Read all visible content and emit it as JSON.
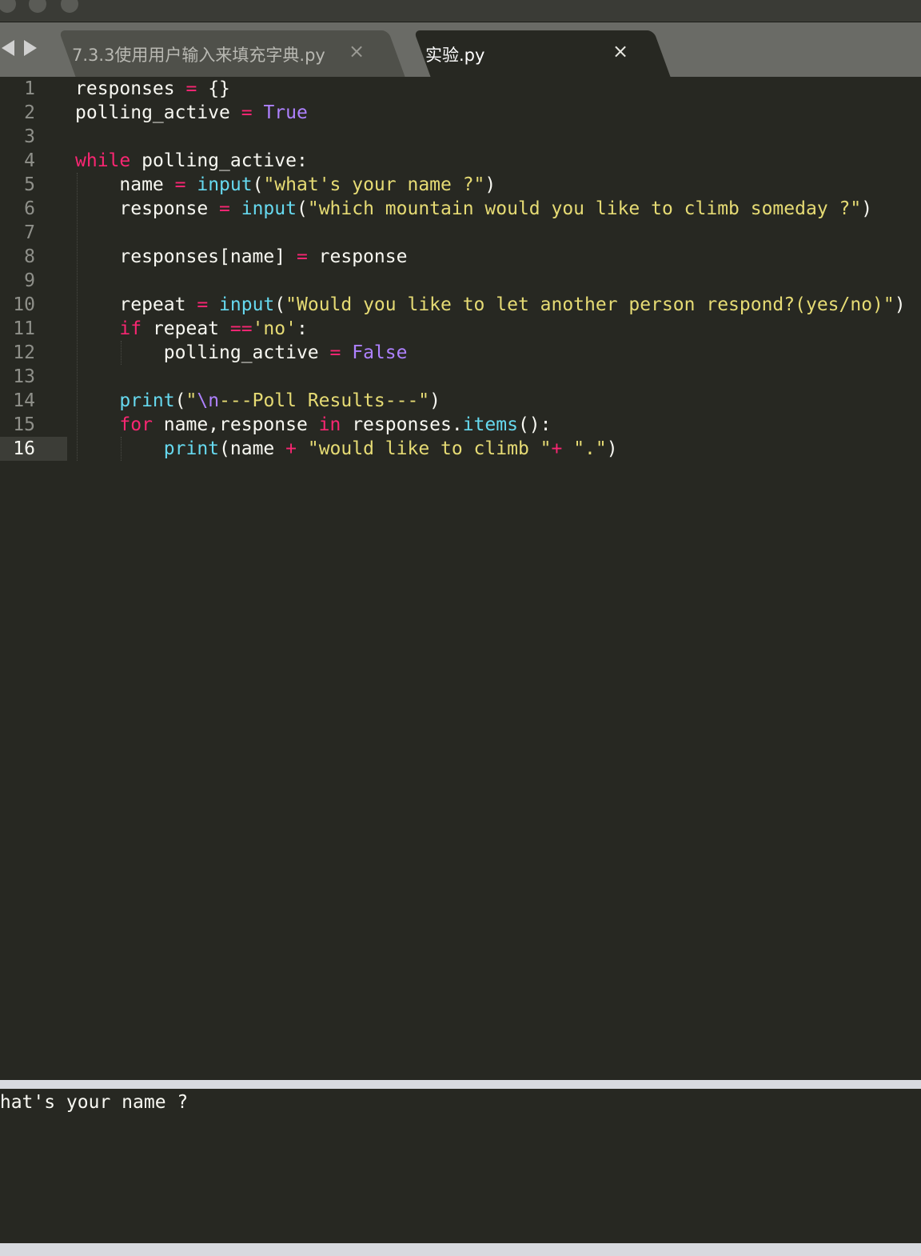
{
  "tabs": [
    {
      "label": "7.3.3使用用户输入来填充字典.py",
      "active": false
    },
    {
      "label": "实验.py",
      "active": true
    }
  ],
  "icons": {
    "back": "triangle-left-icon",
    "forward": "triangle-right-icon",
    "close": "×"
  },
  "editor": {
    "current_line": 16,
    "lines": [
      [
        [
          "responses ",
          "v"
        ],
        [
          "=",
          "k"
        ],
        [
          " {}",
          "v"
        ]
      ],
      [
        [
          "polling_active ",
          "v"
        ],
        [
          "=",
          "k"
        ],
        [
          " ",
          "v"
        ],
        [
          "True",
          "c"
        ]
      ],
      [],
      [
        [
          "while",
          "k"
        ],
        [
          " polling_active:",
          "v"
        ]
      ],
      [
        [
          "    name ",
          "v"
        ],
        [
          "=",
          "k"
        ],
        [
          " ",
          "v"
        ],
        [
          "input",
          "f"
        ],
        [
          "(",
          "v"
        ],
        [
          "\"what's your name ?\"",
          "s"
        ],
        [
          ")",
          "v"
        ]
      ],
      [
        [
          "    response ",
          "v"
        ],
        [
          "=",
          "k"
        ],
        [
          " ",
          "v"
        ],
        [
          "input",
          "f"
        ],
        [
          "(",
          "v"
        ],
        [
          "\"which mountain would you like to climb someday ?\"",
          "s"
        ],
        [
          ")",
          "v"
        ]
      ],
      [],
      [
        [
          "    responses[name] ",
          "v"
        ],
        [
          "=",
          "k"
        ],
        [
          " response",
          "v"
        ]
      ],
      [],
      [
        [
          "    repeat ",
          "v"
        ],
        [
          "=",
          "k"
        ],
        [
          " ",
          "v"
        ],
        [
          "input",
          "f"
        ],
        [
          "(",
          "v"
        ],
        [
          "\"Would you like to let another person respond?(yes/no)\"",
          "s"
        ],
        [
          ")",
          "v"
        ]
      ],
      [
        [
          "    ",
          "v"
        ],
        [
          "if",
          "k"
        ],
        [
          " repeat ",
          "v"
        ],
        [
          "==",
          "k"
        ],
        [
          "'no'",
          "s"
        ],
        [
          ":",
          "v"
        ]
      ],
      [
        [
          "        polling_active ",
          "v"
        ],
        [
          "=",
          "k"
        ],
        [
          " ",
          "v"
        ],
        [
          "False",
          "c"
        ]
      ],
      [],
      [
        [
          "    ",
          "v"
        ],
        [
          "print",
          "f"
        ],
        [
          "(",
          "v"
        ],
        [
          "\"",
          "s"
        ],
        [
          "\\n",
          "c"
        ],
        [
          "---Poll Results---\"",
          "s"
        ],
        [
          ")",
          "v"
        ]
      ],
      [
        [
          "    ",
          "v"
        ],
        [
          "for",
          "k"
        ],
        [
          " name,response ",
          "v"
        ],
        [
          "in",
          "k"
        ],
        [
          " responses.",
          "v"
        ],
        [
          "items",
          "f"
        ],
        [
          "():",
          "v"
        ]
      ],
      [
        [
          "        ",
          "v"
        ],
        [
          "print",
          "f"
        ],
        [
          "(name ",
          "v"
        ],
        [
          "+",
          "k"
        ],
        [
          " ",
          "v"
        ],
        [
          "\"would like to climb \"",
          "s"
        ],
        [
          "+",
          "k"
        ],
        [
          " ",
          "v"
        ],
        [
          "\".\"",
          "s"
        ],
        [
          ")",
          "v"
        ]
      ]
    ]
  },
  "console": {
    "output": "what's your name ?"
  },
  "colors": {
    "background": "#272822",
    "text": "#f8f8f2",
    "keyword": "#f92672",
    "function": "#66d9ef",
    "string": "#e6db74",
    "constant": "#ae81ff",
    "line_number": "#8f908a",
    "tab_active": "#272822",
    "tab_inactive": "#4f504a",
    "tab_bar": "#6a6b66"
  }
}
